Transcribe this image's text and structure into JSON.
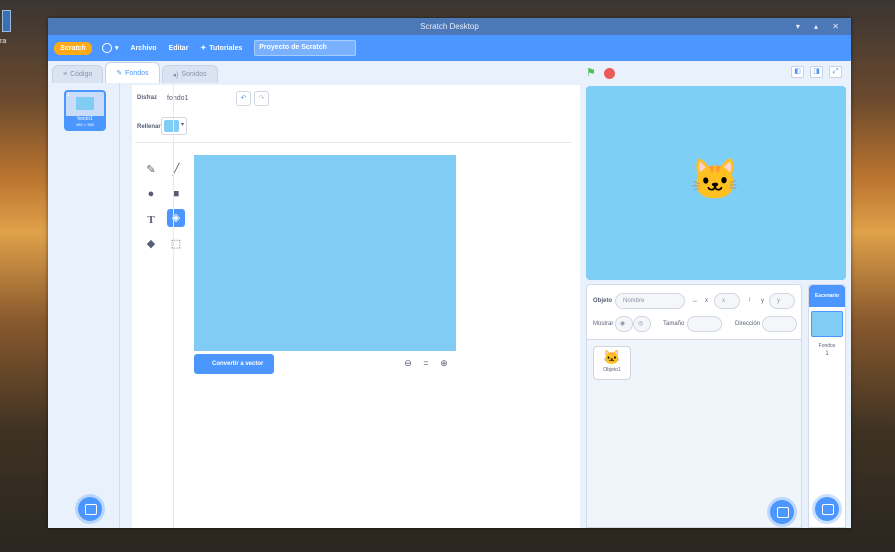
{
  "desktop": {
    "label": "ra"
  },
  "window": {
    "title": "Scratch Desktop",
    "controls": "▾ ▴ ✕"
  },
  "menubar": {
    "logo": "Scratch",
    "items": [
      "Archivo",
      "Editar",
      "Tutoriales"
    ],
    "project_title": "Proyecto de Scratch"
  },
  "tabs": [
    {
      "label": "Código"
    },
    {
      "label": "Fondos"
    },
    {
      "label": "Sonidos"
    }
  ],
  "costume": {
    "number": "1",
    "name": "fondo1",
    "size": "480 × 360"
  },
  "editor": {
    "name_label": "Disfraz",
    "name_value": "fondo1",
    "fill_label": "Rellenar",
    "fill_color": "#80ccf5",
    "convert_label": "Convertir a vector",
    "zoom_reset": "="
  },
  "sprite_info": {
    "sprite_label": "Objeto",
    "name_placeholder": "Nombre",
    "x_label": "x",
    "x_placeholder": "x",
    "y_label": "y",
    "y_placeholder": "y",
    "show_label": "Mostrar",
    "size_label": "Tamaño",
    "direction_label": "Dirección"
  },
  "sprites": [
    {
      "name": "Objeto1"
    }
  ],
  "stage_panel": {
    "header": "Escenario",
    "backdrops_label": "Fondos",
    "backdrops_count": "1"
  },
  "colors": {
    "accent": "#4c97ff",
    "canvas": "#80ccf5",
    "flag": "#4cbf56",
    "stop": "#ec5959"
  }
}
